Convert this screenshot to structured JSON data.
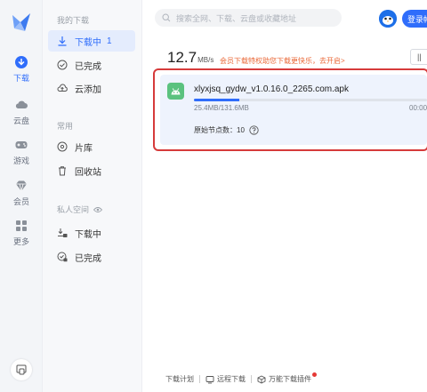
{
  "rail": {
    "items": [
      {
        "label": "下载",
        "icon": "download-icon",
        "active": true
      },
      {
        "label": "云盘",
        "icon": "cloud-icon"
      },
      {
        "label": "游戏",
        "icon": "gamepad-icon"
      },
      {
        "label": "会员",
        "icon": "diamond-icon"
      },
      {
        "label": "更多",
        "icon": "grid-icon"
      }
    ]
  },
  "sidebar": {
    "section_downloads": "我的下载",
    "items": [
      {
        "label": "下载中",
        "count": "1",
        "icon": "download-icon",
        "active": true
      },
      {
        "label": "已完成",
        "icon": "check-circle-icon"
      },
      {
        "label": "云添加",
        "icon": "cloud-upload-icon"
      }
    ],
    "section_common": "常用",
    "common_items": [
      {
        "label": "片库",
        "icon": "film-icon"
      },
      {
        "label": "回收站",
        "icon": "trash-icon"
      }
    ],
    "section_private": "私人空间",
    "private_items": [
      {
        "label": "下载中",
        "icon": "lock-download-icon"
      },
      {
        "label": "已完成",
        "icon": "lock-check-icon"
      }
    ]
  },
  "header": {
    "search_placeholder": "搜索全网、下载、云盘或收藏地址",
    "login_label": "登录帐号"
  },
  "status": {
    "speed_value": "12.7",
    "speed_unit": "MB/s",
    "promo_text": "会员下载特权助您下载更快乐，去开启>",
    "pause_label": "||"
  },
  "task": {
    "filename": "xlyxjsq_gydw_v1.0.16.0_2265.com.apk",
    "size_text": "25.4MB/131.6MB",
    "progress": 0.193,
    "time_text": "00:00",
    "nodes_text": "原始节点数：10"
  },
  "footer": {
    "items": [
      "下载计划",
      "远程下载",
      "万能下载插件"
    ]
  },
  "colors": {
    "accent": "#2f6dfb",
    "highlight": "#d63b3b",
    "promo": "#ea6a3a",
    "apk": "#5bc27f"
  }
}
